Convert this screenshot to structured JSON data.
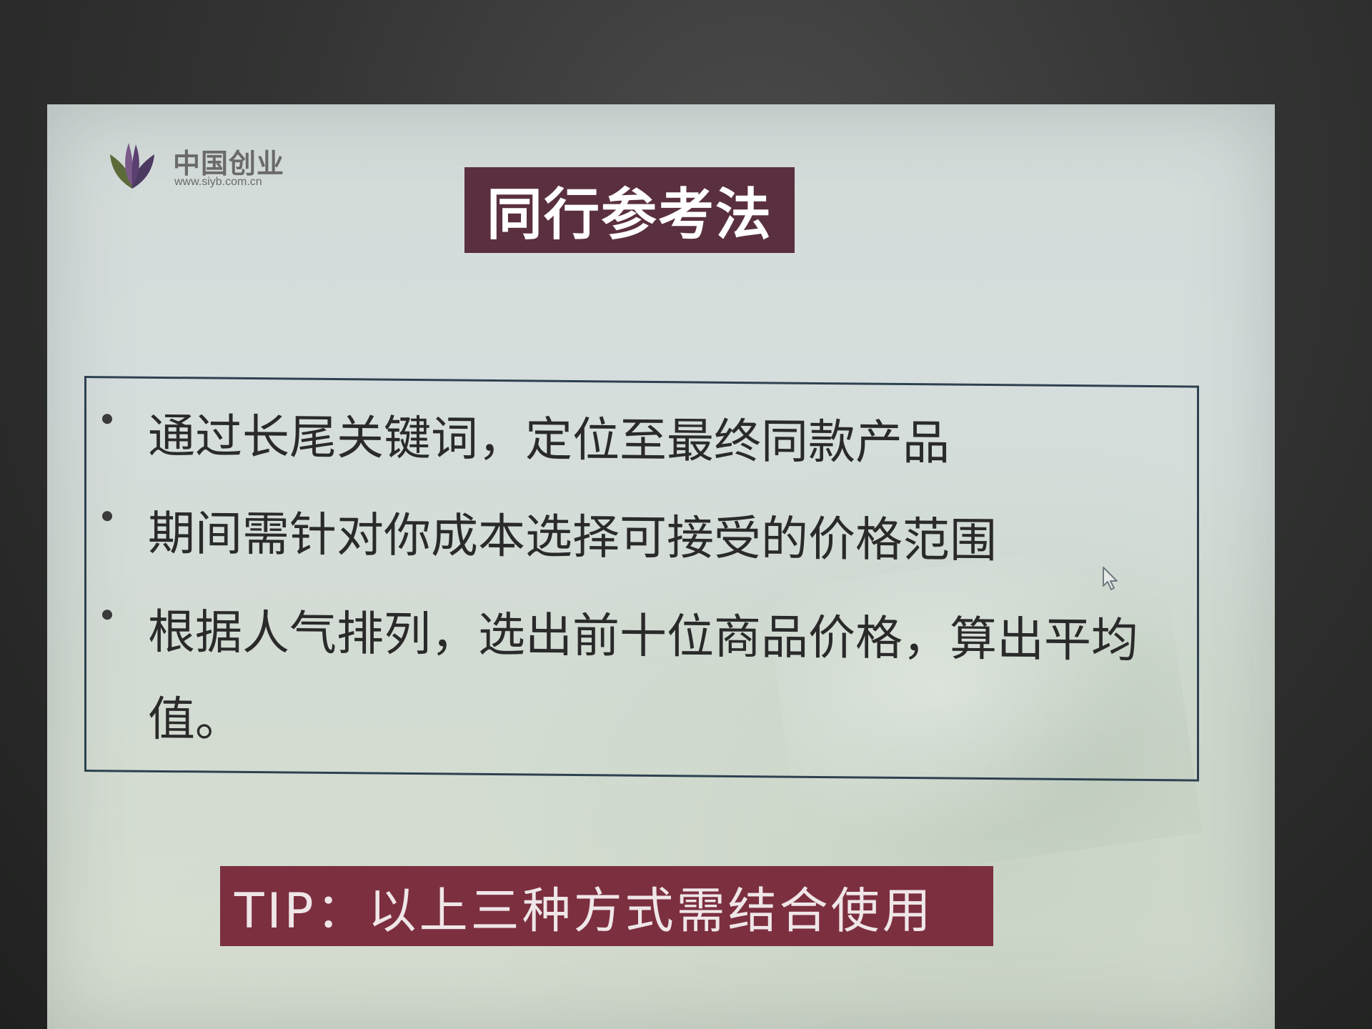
{
  "logo": {
    "name": "中国创业",
    "url": "www.siyb.com.cn"
  },
  "title": "同行参考法",
  "bullets": [
    "通过长尾关键词，定位至最终同款产品",
    "期间需针对你成本选择可接受的价格范围",
    "根据人气排列，选出前十位商品价格，算出平均值。"
  ],
  "tip": "TIP：以上三种方式需结合使用",
  "icons": {
    "logo_mark": "flower-logo-icon",
    "bullet": "bullet-dot-icon",
    "cursor": "mouse-pointer-icon"
  },
  "colors": {
    "title_bg": "#5a3040",
    "tip_bg": "#7c2f3f",
    "box_border": "#2e4150",
    "slide_bg": "#d4dcda"
  }
}
